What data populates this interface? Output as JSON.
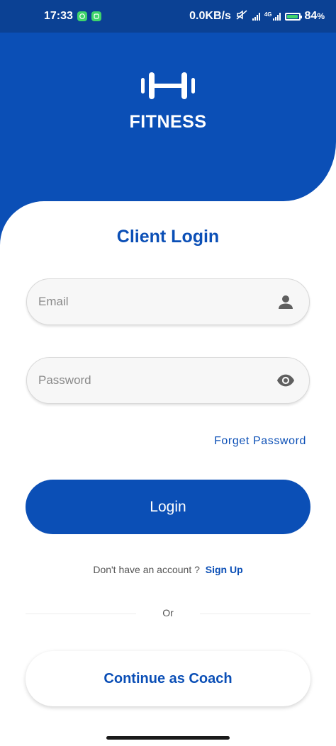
{
  "status_bar": {
    "time": "17:33",
    "network_speed": "0.0KB/s",
    "network_type": "4G",
    "battery_percent": "84",
    "battery_suffix": "%",
    "icons": [
      "whatsapp-icon",
      "notification-app-icon",
      "mute-icon",
      "signal-icon",
      "signal-4g-icon",
      "battery-icon"
    ]
  },
  "brand": {
    "name": "FITNESS",
    "logo_icon": "dumbbell-icon"
  },
  "login": {
    "title": "Client Login",
    "email_placeholder": "Email",
    "password_placeholder": "Password",
    "email_icon": "person-icon",
    "password_icon": "eye-icon",
    "forget_password": "Forget Password",
    "login_button": "Login",
    "no_account_text": "Don't have an account ?",
    "sign_up_link": "Sign Up",
    "or_text": "Or",
    "coach_button": "Continue as Coach"
  },
  "colors": {
    "primary": "#0b4fb6",
    "status_bar": "#0b4194",
    "background": "#ffffff",
    "field_bg": "#f7f7f7"
  }
}
